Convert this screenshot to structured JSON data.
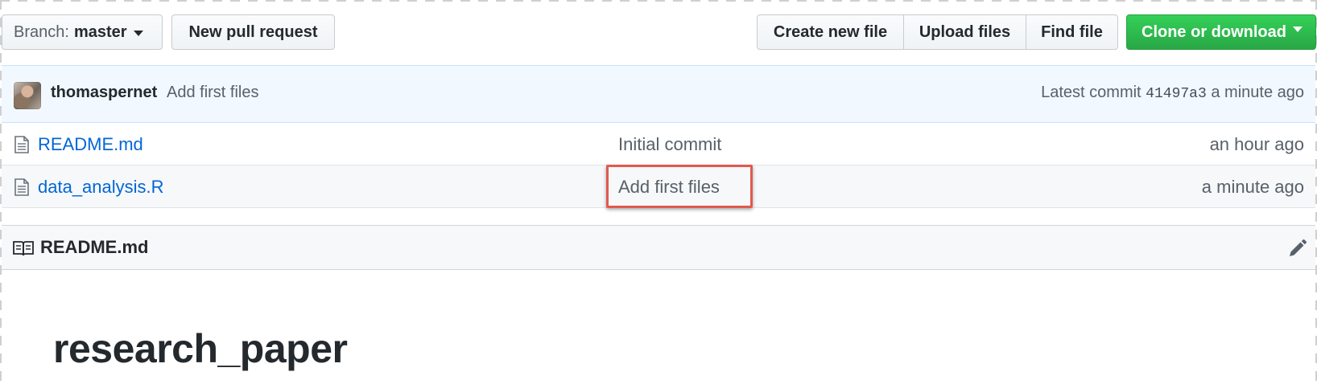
{
  "toolbar": {
    "branch_prefix": "Branch:",
    "branch_name": "master",
    "new_pull_request": "New pull request",
    "create_new_file": "Create new file",
    "upload_files": "Upload files",
    "find_file": "Find file",
    "clone_or_download": "Clone or download"
  },
  "latest_commit": {
    "author": "thomaspernet",
    "message": "Add first files",
    "label": "Latest commit",
    "sha": "41497a3",
    "age": "a minute ago"
  },
  "files": [
    {
      "name": "README.md",
      "commit_message": "Initial commit",
      "age": "an hour ago",
      "icon": "file-icon"
    },
    {
      "name": "data_analysis.R",
      "commit_message": "Add first files",
      "age": "a minute ago",
      "icon": "file-icon"
    }
  ],
  "readme": {
    "filename": "README.md",
    "heading": "research_paper"
  },
  "colors": {
    "accent_green": "#28a745",
    "link_blue": "#0366d6",
    "highlight_red": "#e05a4e",
    "commit_bg": "#f1f8ff"
  }
}
